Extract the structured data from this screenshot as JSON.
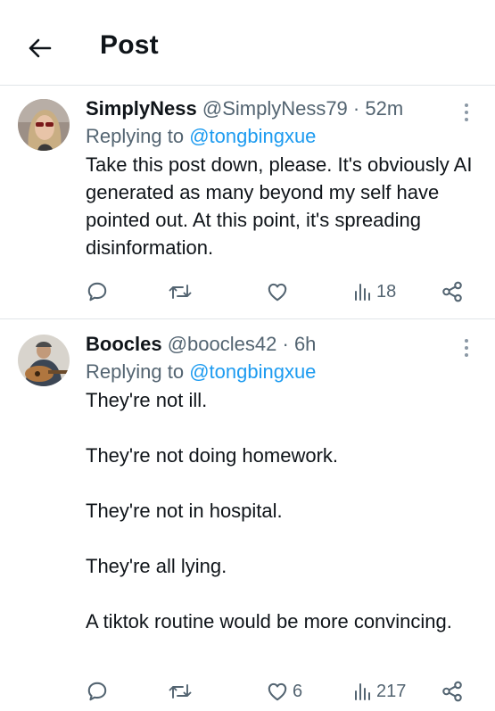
{
  "header": {
    "title": "Post",
    "back_icon": "arrow-left-icon"
  },
  "replies": [
    {
      "display_name": "SimplyNess",
      "handle": "@SimplyNess79",
      "separator": "·",
      "time": "52m",
      "replying_prefix": "Replying to",
      "replying_to": "@tongbingxue",
      "text_lines": [
        "Take this post down, please. It's obviously AI generated as many beyond my self have pointed out. At this point, it's spreading disinformation."
      ],
      "actions": {
        "reply_count": "",
        "retweet_count": "",
        "like_count": "",
        "views_count": "18"
      }
    },
    {
      "display_name": "Boocles",
      "handle": "@boocles42",
      "separator": "·",
      "time": "6h",
      "replying_prefix": "Replying to",
      "replying_to": "@tongbingxue",
      "text_lines": [
        "They're not ill.",
        "They're not doing homework.",
        "They're not in hospital.",
        "They're all lying.",
        "A tiktok routine would be more convincing."
      ],
      "actions": {
        "reply_count": "",
        "retweet_count": "",
        "like_count": "6",
        "views_count": "217"
      }
    }
  ],
  "colors": {
    "text_primary": "#0f1419",
    "text_secondary": "#536471",
    "link": "#1d9bf0",
    "divider": "#e1e5e8"
  }
}
